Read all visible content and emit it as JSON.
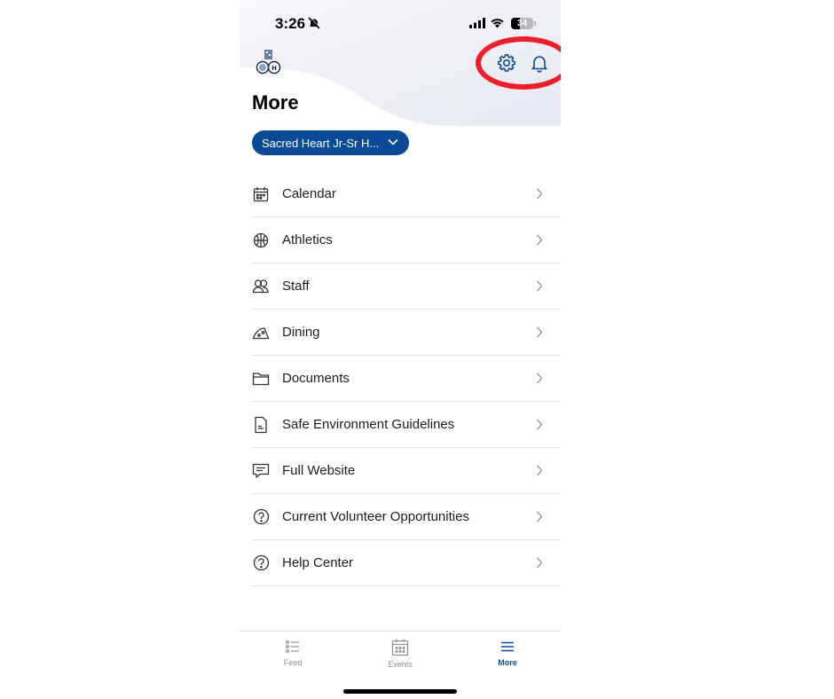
{
  "status_bar": {
    "time": "3:26",
    "battery": "34"
  },
  "page": {
    "title": "More"
  },
  "school_selector": {
    "label": "Sacred Heart Jr-Sr H..."
  },
  "menu": {
    "items": [
      {
        "label": "Calendar",
        "icon": "calendar-icon"
      },
      {
        "label": "Athletics",
        "icon": "basketball-icon"
      },
      {
        "label": "Staff",
        "icon": "staff-icon"
      },
      {
        "label": "Dining",
        "icon": "pizza-icon"
      },
      {
        "label": "Documents",
        "icon": "folder-icon"
      },
      {
        "label": "Safe Environment Guidelines",
        "icon": "document-icon"
      },
      {
        "label": "Full Website",
        "icon": "website-icon"
      },
      {
        "label": "Current Volunteer Opportunities",
        "icon": "help-icon"
      },
      {
        "label": "Help Center",
        "icon": "help-icon"
      }
    ]
  },
  "tabbar": {
    "tabs": [
      {
        "label": "Feed",
        "icon": "list-icon",
        "active": false
      },
      {
        "label": "Events",
        "icon": "calendar-icon",
        "active": false
      },
      {
        "label": "More",
        "icon": "menu-icon",
        "active": true
      }
    ]
  },
  "colors": {
    "accent": "#0a4a97",
    "highlight": "#ee1f2b",
    "divider": "#e5e5ea"
  }
}
